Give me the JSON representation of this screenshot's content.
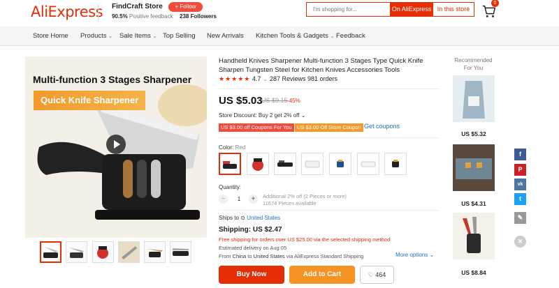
{
  "header": {
    "logo": "AliExpress",
    "store_name": "FindCraft Store",
    "feedback_pct": "90.5%",
    "feedback_label": "Positive feedback",
    "follow_label": "+ Follow",
    "followers_count": "238",
    "followers_label": "Followers",
    "search_placeholder": "I'm shopping for...",
    "search_aliexpress": "On AliExpress",
    "search_store": "In this store",
    "cart_count": "0"
  },
  "nav": {
    "items": [
      "Store Home",
      "Products",
      "Sale Items",
      "Top Selling",
      "New Arrivals",
      "Kitchen Tools & Gadgets",
      "Feedback"
    ]
  },
  "gallery": {
    "headline_1": "Multi-function 3 Stages Sharpener",
    "headline_2": "Quick Knife Sharpener"
  },
  "product": {
    "title": "Handheld Knives Sharpener Multi-function 3 Stages Type Quick Knife Sharpen Tungsten Steel for Kitchen Knives Accessories Tools",
    "stars": "★★★★★",
    "rating": "4.7",
    "reviews": "287 Reviews",
    "orders": "981 orders",
    "price": "US $5.03",
    "old_price": "US $9.15",
    "discount": "-45%",
    "store_discount": "Store Discount: Buy 2 get 2% off",
    "coupon_1": "US $3.00 off Coupons For You",
    "coupon_2": "US $3.00 Off Store Coupon",
    "get_coupons": "Get coupons",
    "color_label": "Color:",
    "color_value": "Red",
    "quantity_label": "Quantity:",
    "quantity_value": "1",
    "quantity_note_1": "Additional 2% off (2 Pieces or more)",
    "quantity_note_2": "11674 Pieces available",
    "ships_to_label": "Ships to",
    "ships_to_value": "United States",
    "shipping": "Shipping: US $2.47",
    "free_shipping": "Free shipping for orders over US $25.00 via the selected shipping method",
    "delivery": "Estimated delivery on Aug 05",
    "from_prefix": "From",
    "from_country": "China",
    "from_mid": "to",
    "from_dest": "United States",
    "from_suffix": "via AliExpress Standard Shipping",
    "more_options": "More options",
    "buy_now": "Buy Now",
    "add_to_cart": "Add to Cart",
    "wishlist_count": "464"
  },
  "recommended": {
    "title": "Recommended For You",
    "items": [
      {
        "price": "US $5.32"
      },
      {
        "price": "US $4.31"
      },
      {
        "price": "US $8.84"
      }
    ]
  },
  "social": [
    {
      "icon": "facebook-icon",
      "glyph": "f",
      "color": "#3b5998"
    },
    {
      "icon": "pinterest-icon",
      "glyph": "P",
      "color": "#cb2027"
    },
    {
      "icon": "vk-icon",
      "glyph": "vk",
      "color": "#4c75a3"
    },
    {
      "icon": "twitter-icon",
      "glyph": "t",
      "color": "#1da1f2"
    },
    {
      "icon": "edit-icon",
      "glyph": "✎",
      "color": "#999999"
    }
  ],
  "colors": {
    "brand": "#e62e04",
    "orange": "#f79322",
    "link": "#2371c4"
  }
}
